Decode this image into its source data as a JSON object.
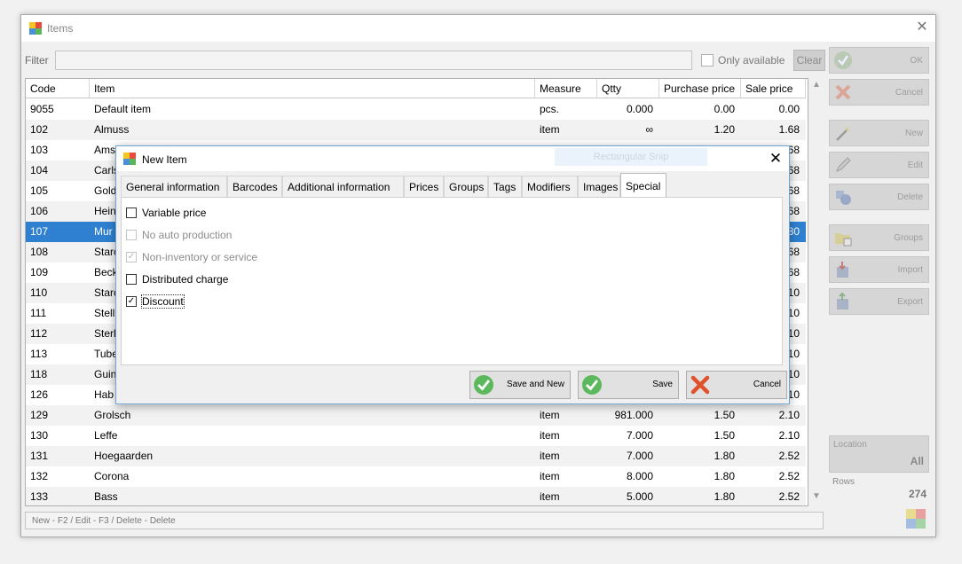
{
  "window": {
    "title": "Items",
    "close_glyph": "✕"
  },
  "filter": {
    "label": "Filter",
    "value": "",
    "only_available_label": "Only available",
    "clear_label": "Clear"
  },
  "grid": {
    "columns": [
      "Code",
      "Item",
      "Measure",
      "Qtty",
      "Purchase price",
      "Sale price"
    ],
    "rows": [
      [
        "9055",
        "Default item",
        "pcs.",
        "0.000",
        "0.00",
        "0.00"
      ],
      [
        "102",
        "Almuss",
        "item",
        "∞",
        "1.20",
        "1.68"
      ],
      [
        "103",
        "Ams",
        "",
        "",
        "",
        "68"
      ],
      [
        "104",
        "Carls",
        "",
        "",
        "",
        "68"
      ],
      [
        "105",
        "Gold",
        "",
        "",
        "",
        "68"
      ],
      [
        "106",
        "Hein",
        "",
        "",
        "",
        "68"
      ],
      [
        "107",
        "Mur",
        "",
        "",
        "",
        "80"
      ],
      [
        "108",
        "Starc",
        "",
        "",
        "",
        "68"
      ],
      [
        "109",
        "Beck",
        "",
        "",
        "",
        "68"
      ],
      [
        "110",
        "Starc",
        "",
        "",
        "",
        "10"
      ],
      [
        "111",
        "Stell",
        "",
        "",
        "",
        "10"
      ],
      [
        "112",
        "Sterl",
        "",
        "",
        "",
        "10"
      ],
      [
        "113",
        "Tube",
        "",
        "",
        "",
        "10"
      ],
      [
        "118",
        "Guin",
        "",
        "",
        "",
        "10"
      ],
      [
        "126",
        "Hab",
        "",
        "",
        "",
        "10"
      ],
      [
        "129",
        "Grolsch",
        "item",
        "981.000",
        "1.50",
        "2.10"
      ],
      [
        "130",
        "Leffe",
        "item",
        "7.000",
        "1.50",
        "2.10"
      ],
      [
        "131",
        "Hoegaarden",
        "item",
        "7.000",
        "1.80",
        "2.52"
      ],
      [
        "132",
        "Corona",
        "item",
        "8.000",
        "1.80",
        "2.52"
      ],
      [
        "133",
        "Bass",
        "item",
        "5.000",
        "1.80",
        "2.52"
      ]
    ],
    "selected_row": 6
  },
  "status_bar": "New - F2 / Edit - F3 / Delete - Delete",
  "side_buttons": [
    {
      "label": "OK",
      "icon": "check-icon"
    },
    {
      "label": "Cancel",
      "icon": "cross-icon"
    },
    {
      "label": "New",
      "icon": "wand-icon"
    },
    {
      "label": "Edit",
      "icon": "pencil-icon"
    },
    {
      "label": "Delete",
      "icon": "delete-icon"
    },
    {
      "label": "Groups",
      "icon": "folder-icon"
    },
    {
      "label": "Import",
      "icon": "import-icon"
    },
    {
      "label": "Export",
      "icon": "export-icon"
    }
  ],
  "location": {
    "label": "Location",
    "value": "All"
  },
  "rows_info": {
    "label": "Rows",
    "count": "274"
  },
  "dialog": {
    "title": "New Item",
    "close_glyph": "✕",
    "ghost_text": "Rectangular Snip",
    "tabs": [
      "General information",
      "Barcodes",
      "Additional information",
      "Prices",
      "Groups",
      "Tags",
      "Modifiers",
      "Images",
      "Special"
    ],
    "active_tab": "Special",
    "options": [
      {
        "label": "Variable price",
        "checked": false,
        "disabled": false
      },
      {
        "label": "No auto production",
        "checked": false,
        "disabled": true
      },
      {
        "label": "Non-inventory or service",
        "checked": true,
        "disabled": true
      },
      {
        "label": "Distributed charge",
        "checked": false,
        "disabled": false
      },
      {
        "label": "Discount",
        "checked": true,
        "disabled": false
      }
    ],
    "buttons": {
      "save_new": "Save and New",
      "save": "Save",
      "cancel": "Cancel"
    }
  },
  "colors": {
    "selection": "#2f80d1",
    "check_green": "#5cb85c",
    "cross_red": "#e0522b",
    "dialog_border": "#6fa4d9"
  }
}
